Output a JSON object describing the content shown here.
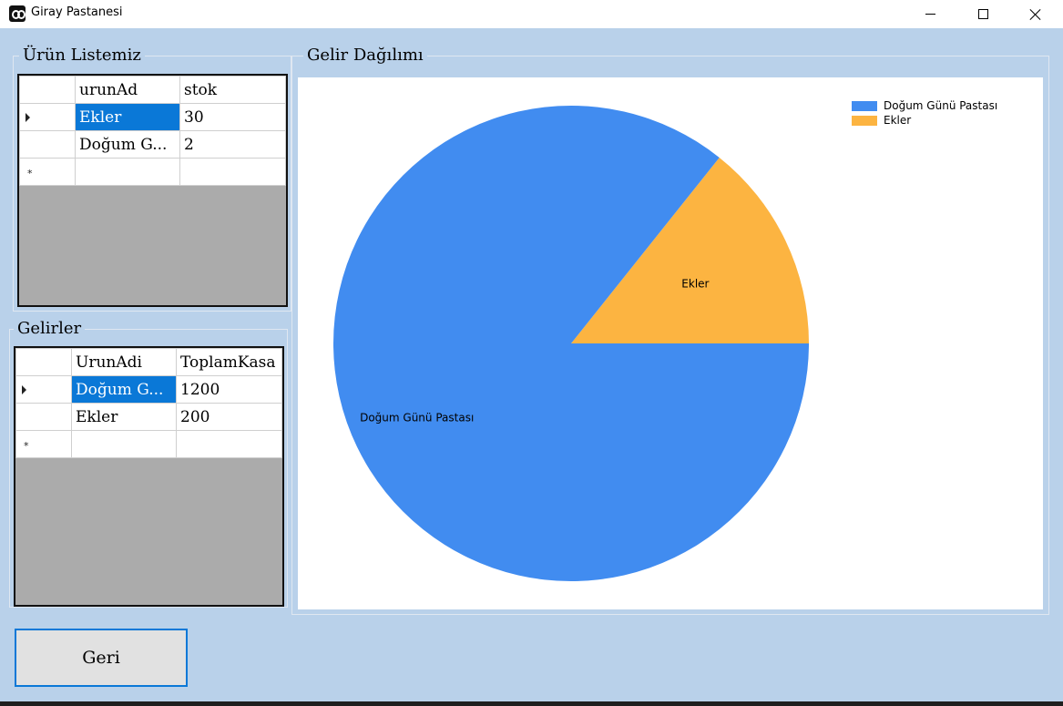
{
  "window": {
    "title": "Giray Pastanesi"
  },
  "products_group": {
    "title": "Ürün Listemiz",
    "columns": [
      "urunAd",
      "stok"
    ],
    "rows": [
      {
        "urunAd": "Ekler",
        "stok": "30"
      },
      {
        "urunAd": "Doğum G...",
        "stok": "2"
      }
    ]
  },
  "income_group": {
    "title": "Gelirler",
    "columns": [
      "UrunAdi",
      "ToplamKasa"
    ],
    "rows": [
      {
        "UrunAdi": "Doğum G...",
        "ToplamKasa": "1200"
      },
      {
        "UrunAdi": "Ekler",
        "ToplamKasa": "200"
      }
    ]
  },
  "chart_group": {
    "title": "Gelir Dağılımı"
  },
  "chart_data": {
    "type": "pie",
    "categories": [
      "Doğum Günü Pastası",
      "Ekler"
    ],
    "values": [
      1200,
      200
    ],
    "colors": [
      "#418cf0",
      "#fcb441"
    ],
    "legend_position": "top-right"
  },
  "buttons": {
    "back": "Geri"
  }
}
